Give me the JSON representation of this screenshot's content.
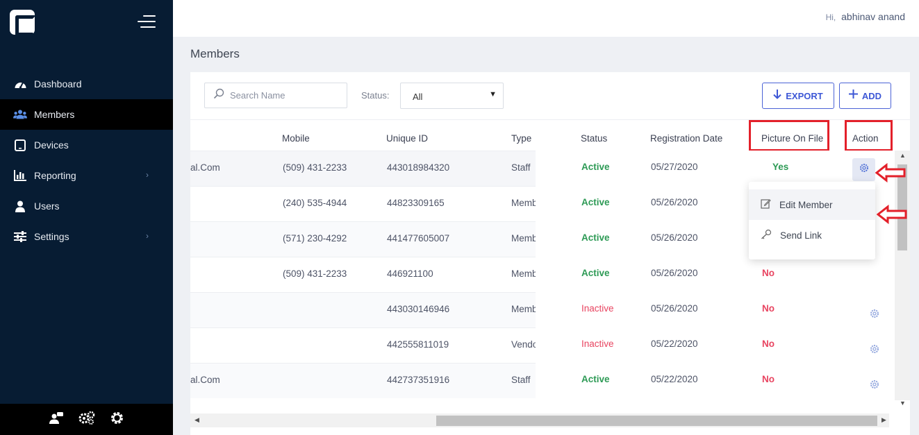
{
  "header": {
    "greeting_prefix": "Hi,",
    "user_name": "abhinav anand"
  },
  "sidebar": {
    "items": [
      {
        "label": "Dashboard",
        "icon": "gauge-icon",
        "active": false
      },
      {
        "label": "Members",
        "icon": "users-icon",
        "active": true
      },
      {
        "label": "Devices",
        "icon": "tablet-icon",
        "active": false
      },
      {
        "label": "Reporting",
        "icon": "bar-chart-icon",
        "active": false,
        "expandable": true
      },
      {
        "label": "Users",
        "icon": "user-icon",
        "active": false
      },
      {
        "label": "Settings",
        "icon": "sliders-icon",
        "active": false,
        "expandable": true
      }
    ],
    "footer_icons": [
      "user-chat-icon",
      "cogs-icon",
      "gear-icon"
    ]
  },
  "page": {
    "title": "Members"
  },
  "toolbar": {
    "search_placeholder": "Search Name",
    "status_label": "Status:",
    "status_value": "All",
    "export_label": "EXPORT",
    "add_label": "ADD"
  },
  "table": {
    "columns": [
      "Mobile",
      "Unique ID",
      "Type",
      "Status",
      "Registration Date",
      "Picture On File",
      "Action"
    ],
    "rows": [
      {
        "email_tail": "al.Com",
        "mobile": "(509) 431-2233",
        "unique_id": "443018984320",
        "type": "Staff",
        "status": "Active",
        "date": "05/27/2020",
        "picture": "Yes"
      },
      {
        "email_tail": "",
        "mobile": "(240) 535-4944",
        "unique_id": "44823309165",
        "type": "Member",
        "status": "Active",
        "date": "05/26/2020",
        "picture": ""
      },
      {
        "email_tail": "",
        "mobile": "(571) 230-4292",
        "unique_id": "441477605007",
        "type": "Member",
        "status": "Active",
        "date": "05/26/2020",
        "picture": ""
      },
      {
        "email_tail": "",
        "mobile": "(509) 431-2233",
        "unique_id": "446921100",
        "type": "Member",
        "status": "Active",
        "date": "05/26/2020",
        "picture": "No"
      },
      {
        "email_tail": "",
        "mobile": "",
        "unique_id": "443030146946",
        "type": "Member",
        "status": "Inactive",
        "date": "05/26/2020",
        "picture": "No"
      },
      {
        "email_tail": "",
        "mobile": "",
        "unique_id": "442555811019",
        "type": "Vendor",
        "status": "Inactive",
        "date": "05/22/2020",
        "picture": "No"
      },
      {
        "email_tail": "al.Com",
        "mobile": "",
        "unique_id": "442737351916",
        "type": "Staff",
        "status": "Active",
        "date": "05/22/2020",
        "picture": "No"
      }
    ]
  },
  "action_menu": {
    "items": [
      {
        "label": "Edit Member",
        "icon": "edit-icon"
      },
      {
        "label": "Send Link",
        "icon": "key-icon"
      }
    ]
  },
  "colors": {
    "sidebar_bg": "#071c33",
    "accent": "#3d57d6",
    "active": "#2d9a55",
    "inactive": "#e84460",
    "highlight": "#e3202a"
  }
}
